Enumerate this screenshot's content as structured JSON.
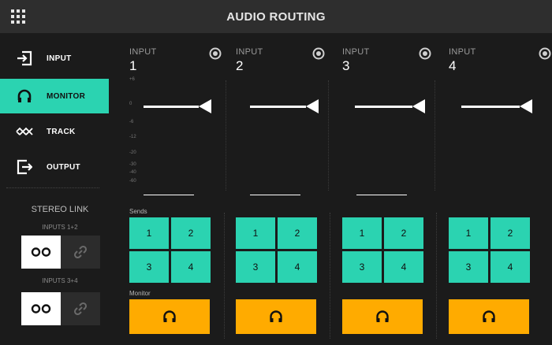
{
  "header": {
    "title": "AUDIO ROUTING",
    "menu_icon": "grid-menu-icon"
  },
  "sidebar": {
    "items": [
      {
        "label": "INPUT",
        "icon": "input-arrow-icon",
        "active": false
      },
      {
        "label": "MONITOR",
        "icon": "headphones-icon",
        "active": true
      },
      {
        "label": "TRACK",
        "icon": "waveform-icon",
        "active": false
      },
      {
        "label": "OUTPUT",
        "icon": "output-arrow-icon",
        "active": false
      }
    ]
  },
  "stereo_link": {
    "title": "STEREO LINK",
    "groups": [
      {
        "label": "INPUTS 1+2",
        "unlinked_icon": "two-circles-icon",
        "linked_icon": "link-icon"
      },
      {
        "label": "INPUTS 3+4",
        "unlinked_icon": "two-circles-icon",
        "linked_icon": "link-icon"
      }
    ]
  },
  "scale_ticks": [
    "+6",
    "0",
    "-6",
    "-12",
    "-20",
    "-30",
    "-40",
    "-60"
  ],
  "channels": [
    {
      "label": "INPUT",
      "number": "1",
      "sends_label": "Sends",
      "sends": [
        "1",
        "2",
        "3",
        "4"
      ],
      "monitor_label": "Monitor",
      "fader_db": 0
    },
    {
      "label": "INPUT",
      "number": "2",
      "sends_label": "",
      "sends": [
        "1",
        "2",
        "3",
        "4"
      ],
      "monitor_label": "",
      "fader_db": 0
    },
    {
      "label": "INPUT",
      "number": "3",
      "sends_label": "",
      "sends": [
        "1",
        "2",
        "3",
        "4"
      ],
      "monitor_label": "",
      "fader_db": 0
    },
    {
      "label": "INPUT",
      "number": "4",
      "sends_label": "",
      "sends": [
        "1",
        "2",
        "3",
        "4"
      ],
      "monitor_label": "",
      "fader_db": 0
    }
  ],
  "colors": {
    "accent": "#2bd3b1",
    "monitor": "#ffab00",
    "background": "#1b1b1b",
    "header": "#2e2e2e"
  }
}
